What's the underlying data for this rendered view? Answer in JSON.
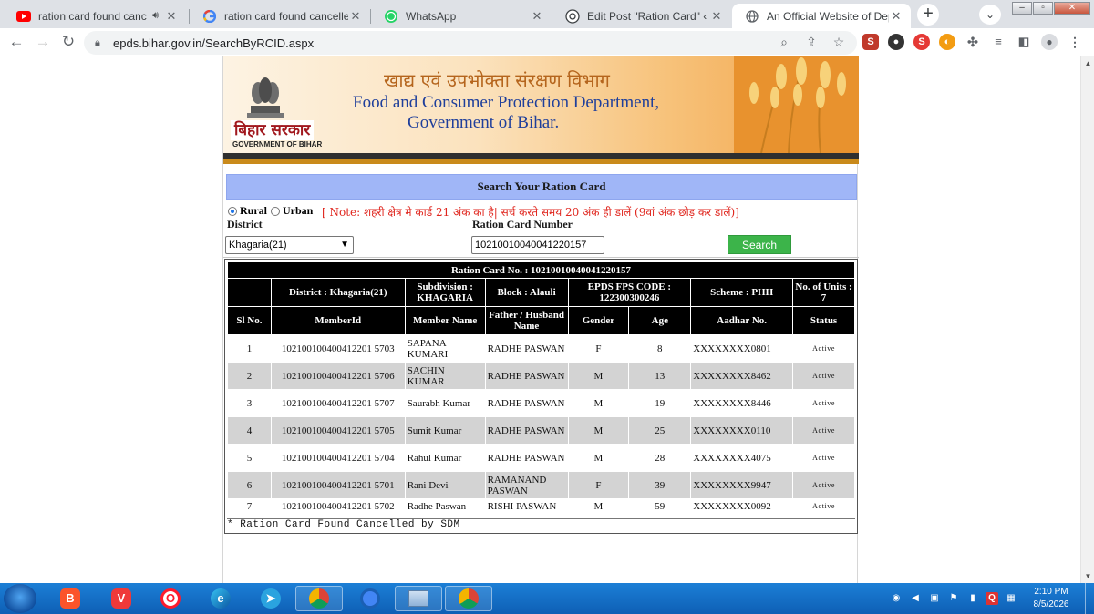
{
  "browser": {
    "tabs": [
      {
        "title": "ration card found cancelle",
        "icon": "youtube-icon",
        "extra": "speaker-icon"
      },
      {
        "title": "ration card found cancelled by",
        "icon": "google-icon"
      },
      {
        "title": "WhatsApp",
        "icon": "whatsapp-icon"
      },
      {
        "title": "Edit Post \"Ration Card\" ‹ Taja",
        "icon": "wordpress-icon"
      },
      {
        "title": "An Official Website of Departm",
        "icon": "globe-icon"
      }
    ],
    "close_glyph": "✕",
    "new_tab_glyph": "+",
    "url": "epds.bihar.gov.in/SearchByRCID.aspx",
    "accent": "#1a73e8"
  },
  "header": {
    "dept_hindi": "खाद्य एवं उपभोक्ता संरक्षण विभाग",
    "dept_english_line1": "Food and Consumer Protection Department,",
    "dept_english_line2": "Government of Bihar.",
    "logo_hindi": "बिहार सरकार",
    "logo_english": "GOVERNMENT OF BIHAR"
  },
  "search": {
    "title": "Search Your Ration Card",
    "rural_label": "Rural",
    "urban_label": "Urban",
    "selected_area": "Rural",
    "note": "[ Note: शहरी क्षेत्र मे कार्ड 21 अंक का है| सर्च करते समय 20 अंक ही डालें (9वां अंक छोड़ कर डालें)]",
    "district_label": "District",
    "district_value": "Khagaria(21)",
    "rc_label": "Ration Card Number",
    "rc_value": "10210010040041220157",
    "button_label": "Search"
  },
  "result": {
    "card_no_header": "Ration Card No. : 10210010040041220157",
    "district": "District : Khagaria(21)",
    "subdivision": "Subdivision : KHAGARIA",
    "block": "Block : Alauli",
    "fps_code": "EPDS FPS CODE : 122300300246",
    "scheme": "Scheme : PHH",
    "units": "No. of Units : 7",
    "columns": [
      "Sl No.",
      "MemberId",
      "Member Name",
      "Father / Husband Name",
      "Gender",
      "Age",
      "Aadhar No.",
      "Status"
    ],
    "rows": [
      {
        "sl": "1",
        "member_id": "102100100400412201 5703",
        "name": "SAPANA KUMARI",
        "father": "RADHE PASWAN",
        "gender": "F",
        "age": "8",
        "aadhar": "XXXXXXXX0801",
        "status": "Active"
      },
      {
        "sl": "2",
        "member_id": "102100100400412201 5706",
        "name": "SACHIN KUMAR",
        "father": "RADHE PASWAN",
        "gender": "M",
        "age": "13",
        "aadhar": "XXXXXXXX8462",
        "status": "Active"
      },
      {
        "sl": "3",
        "member_id": "102100100400412201 5707",
        "name": "Saurabh Kumar",
        "father": "RADHE PASWAN",
        "gender": "M",
        "age": "19",
        "aadhar": "XXXXXXXX8446",
        "status": "Active"
      },
      {
        "sl": "4",
        "member_id": "102100100400412201 5705",
        "name": "Sumit Kumar",
        "father": "RADHE PASWAN",
        "gender": "M",
        "age": "25",
        "aadhar": "XXXXXXXX0110",
        "status": "Active"
      },
      {
        "sl": "5",
        "member_id": "102100100400412201 5704",
        "name": "Rahul Kumar",
        "father": "RADHE PASWAN",
        "gender": "M",
        "age": "28",
        "aadhar": "XXXXXXXX4075",
        "status": "Active"
      },
      {
        "sl": "6",
        "member_id": "102100100400412201 5701",
        "name": "Rani Devi",
        "father": "RAMANAND PASWAN",
        "gender": "F",
        "age": "39",
        "aadhar": "XXXXXXXX9947",
        "status": "Active"
      },
      {
        "sl": "7",
        "member_id": "102100100400412201 5702",
        "name": "Radhe Paswan",
        "father": "RISHI PASWAN",
        "gender": "M",
        "age": "59",
        "aadhar": "XXXXXXXX0092",
        "status": "Active"
      }
    ],
    "footer_note": "* Ration Card Found Cancelled by SDM"
  },
  "taskbar": {
    "time": "2:10 PM",
    "date": "8/5/2026"
  }
}
